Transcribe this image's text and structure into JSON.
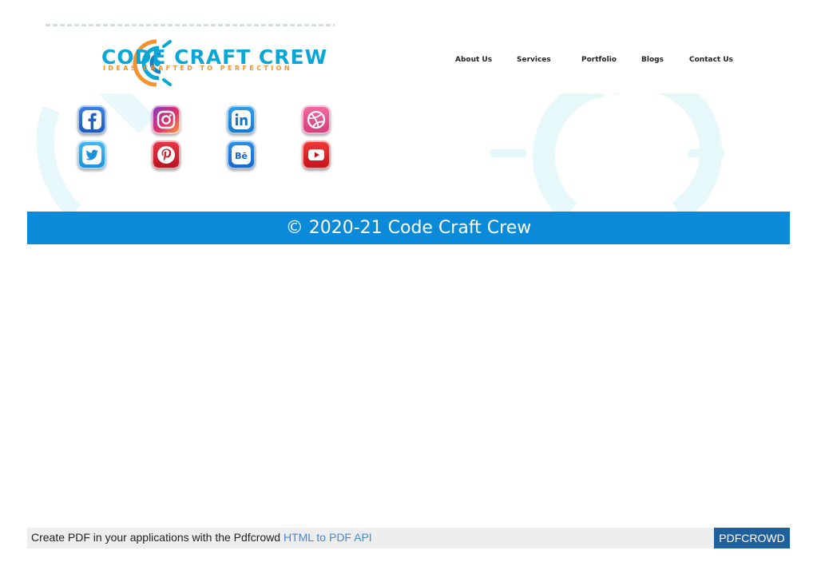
{
  "header": {
    "brand_name": "CODE CRAFT CREW",
    "brand_tagline": "IDEAS CRAFTED TO PERFECTION"
  },
  "nav": {
    "items": [
      {
        "label": "About Us"
      },
      {
        "label": "Services"
      },
      {
        "label": "Portfolio"
      },
      {
        "label": "Blogs"
      },
      {
        "label": "Contact Us"
      }
    ]
  },
  "social": {
    "icons": [
      "facebook-icon",
      "instagram-icon",
      "linkedin-icon",
      "dribbble-icon",
      "twitter-icon",
      "pinterest-icon",
      "behance-icon",
      "youtube-icon"
    ]
  },
  "footer": {
    "copyright": "© 2020-21 Code Craft Crew"
  },
  "pdfcrowd": {
    "text": "Create PDF in your applications with the Pdfcrowd ",
    "link": "HTML to PDF API",
    "brand": "PDFCROWD"
  },
  "colors": {
    "accent_blue": "#0b8ad9",
    "logo_cyan": "#0aa7d6",
    "logo_orange": "#f2932f"
  }
}
